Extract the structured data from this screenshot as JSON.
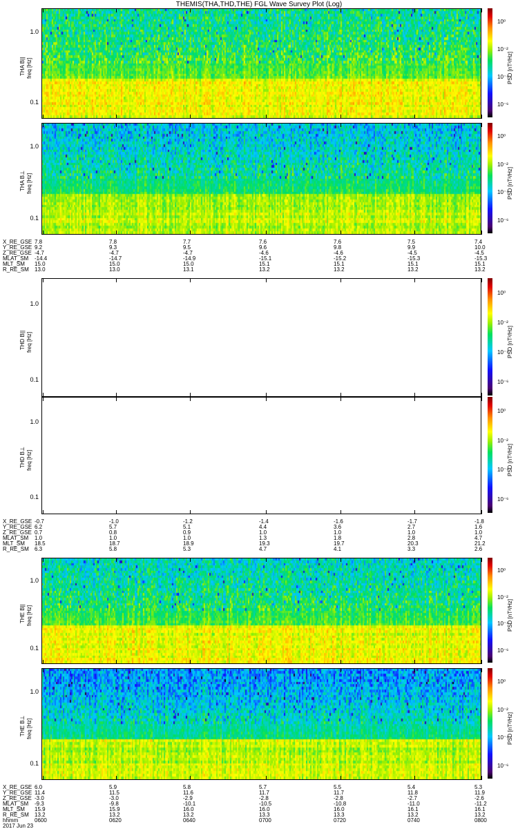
{
  "title": "THEMIS(THA,THD,THE) FGL Wave Survey Plot (Log)",
  "colors": {
    "panel_border": "#000000",
    "background": "#ffffff"
  },
  "chart_data": {
    "type": "heatmap",
    "title": "THEMIS(THA,THD,THE) FGL Wave Survey Plot (Log)",
    "xlabel": "hhmm",
    "date": "2017 Jun 23",
    "x_tick_labels": [
      "0600",
      "0620",
      "0640",
      "0700",
      "0720",
      "0740",
      "0800"
    ],
    "ylim": [
      0.06,
      2.2
    ],
    "yscale": "log",
    "y_tick_labels": [
      "1.0",
      "0.1"
    ],
    "colorbar": {
      "title": "PSD [nT²/Hz]",
      "scale": "log",
      "range": [
        1e-07,
        10.0
      ],
      "tick_labels": [
        "10⁰",
        "10⁻²",
        "10⁻⁴",
        "10⁻⁶"
      ]
    },
    "panels": [
      {
        "name": "THA B‖",
        "ylabel": "THA B||",
        "yunit": "freq [Hz]",
        "has_data": true,
        "low_freq_log_psd": -1.5,
        "high_freq_log_psd": -3.2
      },
      {
        "name": "THA B⊥",
        "ylabel": "THA B⊥",
        "yunit": "freq [Hz]",
        "has_data": true,
        "low_freq_log_psd": -1.8,
        "high_freq_log_psd": -3.8
      },
      {
        "name": "THD B‖",
        "ylabel": "THD B||",
        "yunit": "freq [Hz]",
        "has_data": false
      },
      {
        "name": "THD B⊥",
        "ylabel": "THD B⊥",
        "yunit": "freq [Hz]",
        "has_data": false
      },
      {
        "name": "THE B‖",
        "ylabel": "THE B||",
        "yunit": "freq [Hz]",
        "has_data": true,
        "low_freq_log_psd": -1.5,
        "high_freq_log_psd": -3.5
      },
      {
        "name": "THE B⊥",
        "ylabel": "THE B⊥",
        "yunit": "freq [Hz]",
        "has_data": true,
        "low_freq_log_psd": -1.8,
        "high_freq_log_psd": -4.3
      }
    ],
    "ephemeris": [
      {
        "probe": "THA",
        "rows": [
          {
            "label": "X_RE_GSE",
            "values": [
              "7.8",
              "7.8",
              "7.7",
              "7.6",
              "7.6",
              "7.5",
              "7.4"
            ]
          },
          {
            "label": "Y_RE_GSE",
            "values": [
              "9.2",
              "9.3",
              "9.5",
              "9.6",
              "9.8",
              "9.9",
              "10.0"
            ]
          },
          {
            "label": "Z_RE_GSE",
            "values": [
              "-4.7",
              "-4.7",
              "-4.7",
              "-4.6",
              "-4.6",
              "-4.5",
              "-4.5"
            ]
          },
          {
            "label": "MLAT_SM",
            "values": [
              "-14.4",
              "-14.7",
              "-14.9",
              "-15.1",
              "-15.2",
              "-15.3",
              "-15.3"
            ]
          },
          {
            "label": "MLT_SM",
            "values": [
              "15.0",
              "15.0",
              "15.0",
              "15.1",
              "15.1",
              "15.1",
              "15.1"
            ]
          },
          {
            "label": "R_RE_SM",
            "values": [
              "13.0",
              "13.0",
              "13.1",
              "13.2",
              "13.2",
              "13.2",
              "13.2"
            ]
          }
        ]
      },
      {
        "probe": "THD",
        "rows": [
          {
            "label": "X_RE_GSE",
            "values": [
              "-0.7",
              "-1.0",
              "-1.2",
              "-1.4",
              "-1.6",
              "-1.7",
              "-1.8"
            ]
          },
          {
            "label": "Y_RE_GSE",
            "values": [
              "6.2",
              "5.7",
              "5.1",
              "4.4",
              "3.6",
              "2.7",
              "1.6"
            ]
          },
          {
            "label": "Z_RE_GSE",
            "values": [
              "0.7",
              "0.8",
              "0.9",
              "1.0",
              "1.0",
              "1.0",
              "1.0"
            ]
          },
          {
            "label": "MLAT_SM",
            "values": [
              "1.0",
              "1.0",
              "1.0",
              "1.3",
              "1.8",
              "2.8",
              "4.7"
            ]
          },
          {
            "label": "MLT_SM",
            "values": [
              "18.5",
              "18.7",
              "18.9",
              "19.3",
              "19.7",
              "20.3",
              "21.2"
            ]
          },
          {
            "label": "R_RE_SM",
            "values": [
              "6.3",
              "5.8",
              "5.3",
              "4.7",
              "4.1",
              "3.3",
              "2.6"
            ]
          }
        ]
      },
      {
        "probe": "THE",
        "rows": [
          {
            "label": "X_RE_GSE",
            "values": [
              "6.0",
              "5.9",
              "5.8",
              "5.7",
              "5.5",
              "5.4",
              "5.3"
            ]
          },
          {
            "label": "Y_RE_GSE",
            "values": [
              "11.4",
              "11.5",
              "11.6",
              "11.7",
              "11.7",
              "11.8",
              "11.9"
            ]
          },
          {
            "label": "Z_RE_GSE",
            "values": [
              "-3.0",
              "-3.0",
              "-2.9",
              "-2.8",
              "-2.8",
              "-2.7",
              "-2.6"
            ]
          },
          {
            "label": "MLAT_SM",
            "values": [
              "-9.3",
              "-9.8",
              "-10.1",
              "-10.5",
              "-10.8",
              "-11.0",
              "-11.2"
            ]
          },
          {
            "label": "MLT_SM",
            "values": [
              "15.9",
              "15.9",
              "16.0",
              "16.0",
              "16.0",
              "16.1",
              "16.1"
            ]
          },
          {
            "label": "R_RE_SM",
            "values": [
              "13.2",
              "13.2",
              "13.2",
              "13.3",
              "13.3",
              "13.2",
              "13.2"
            ]
          },
          {
            "label": "hhmm",
            "values": [
              "0600",
              "0620",
              "0640",
              "0700",
              "0720",
              "0740",
              "0800"
            ]
          }
        ]
      }
    ]
  }
}
